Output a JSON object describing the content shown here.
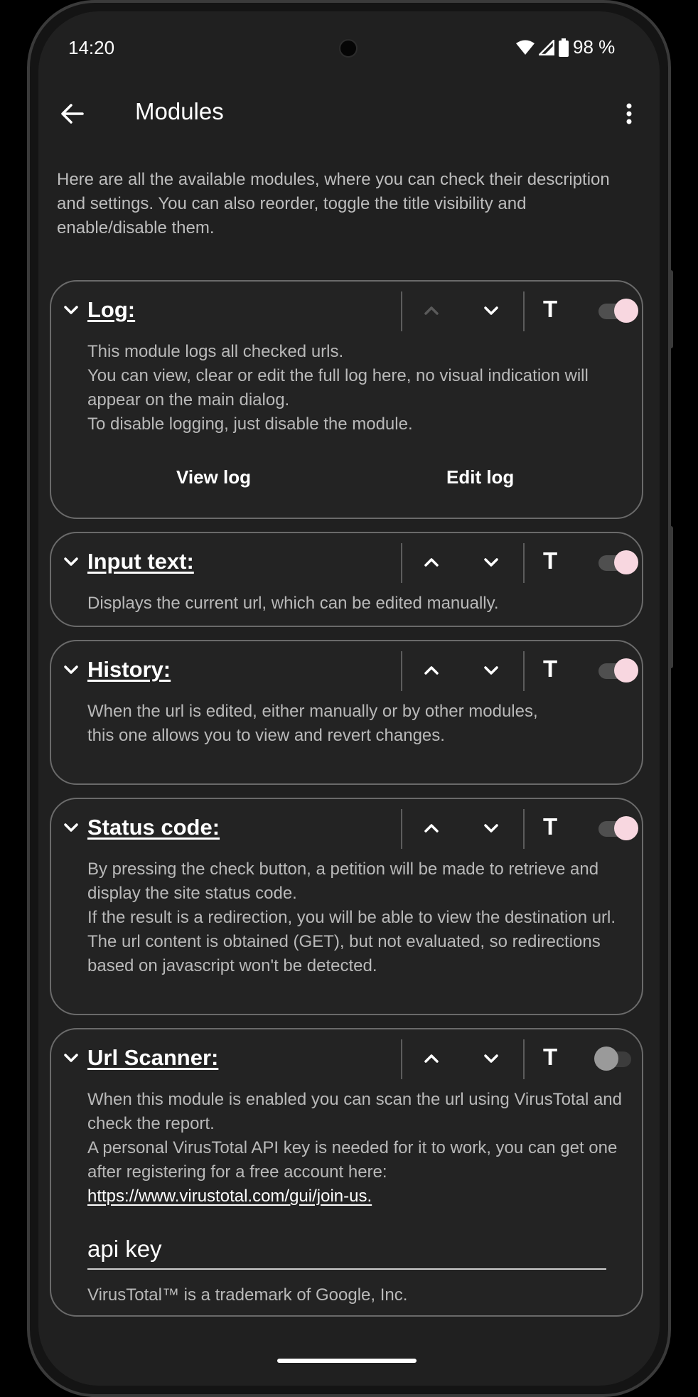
{
  "status_bar": {
    "time": "14:20",
    "battery": "98 %"
  },
  "app_bar": {
    "title": "Modules",
    "back_icon": "arrow-left-icon",
    "menu_icon": "more-vert-icon"
  },
  "intro": "Here are all the available modules, where you can check their description and settings. You can also reorder, toggle the title visibility and enable/disable them.",
  "controls": {
    "title_toggle": "T"
  },
  "modules": [
    {
      "name": "Log:",
      "enabled": true,
      "up_enabled": false,
      "description": [
        "This module logs all checked urls.",
        "You can view, clear or edit the full log here, no visual indication will appear on the main dialog.",
        "To disable logging, just disable the module."
      ],
      "actions": [
        "View log",
        "Edit log"
      ]
    },
    {
      "name": "Input text:",
      "enabled": true,
      "up_enabled": true,
      "description": [
        "Displays the current url, which can be edited manually."
      ]
    },
    {
      "name": "History:",
      "enabled": true,
      "up_enabled": true,
      "description": [
        "When the url is edited, either manually or by other modules, this one allows you to view and revert changes."
      ]
    },
    {
      "name": "Status code:",
      "enabled": true,
      "up_enabled": true,
      "description": [
        "By pressing the check button, a petition will be made to retrieve and display the site status code.",
        "If the result is a redirection, you will be able to view the destination url.",
        "The url content is obtained (GET), but not evaluated, so redirections based on javascript won't be detected."
      ]
    },
    {
      "name": "Url Scanner:",
      "enabled": false,
      "up_enabled": true,
      "description": [
        "When this module is enabled you can scan the url using VirusTotal and check the report.",
        "A personal VirusTotal API key is needed for it to work, you can get one after registering for a free account here:"
      ],
      "link": "https://www.virustotal.com/gui/join-us.",
      "api_key_label": "api key",
      "trademark": "VirusTotal™ is a trademark of Google, Inc."
    }
  ],
  "colors": {
    "switch_thumb_on": "#f8d7e0",
    "card_border": "#6a6a6a",
    "background": "#202020"
  }
}
